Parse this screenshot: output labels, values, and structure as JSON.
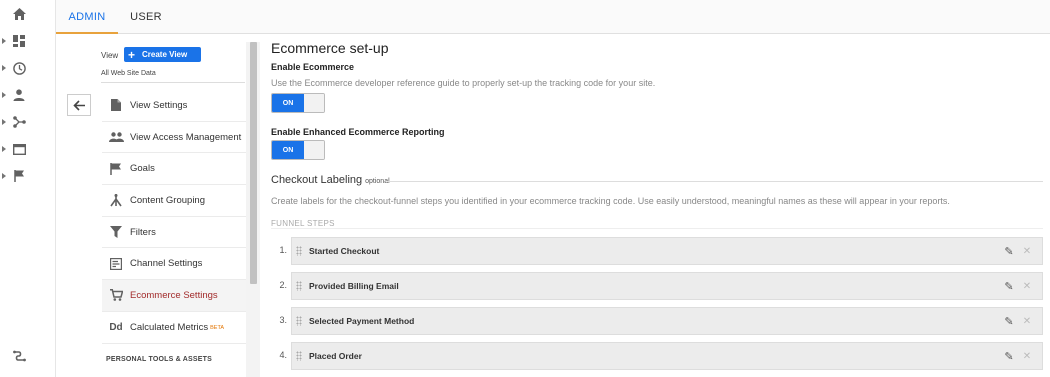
{
  "rail": {
    "icons": [
      "home-icon",
      "dashboards-icon",
      "clock-icon",
      "person-icon",
      "acquisition-icon",
      "behavior-icon",
      "flag-icon",
      "discover-icon"
    ]
  },
  "tabs": [
    {
      "label": "ADMIN",
      "active": true
    },
    {
      "label": "USER",
      "active": false
    }
  ],
  "panel": {
    "view_label": "View",
    "create_view_label": "Create View",
    "view_name": "All Web Site Data",
    "items": [
      {
        "label": "View Settings",
        "icon": "document-icon",
        "active": false
      },
      {
        "label": "View Access Management",
        "icon": "people-icon",
        "active": false
      },
      {
        "label": "Goals",
        "icon": "flag-icon",
        "active": false
      },
      {
        "label": "Content Grouping",
        "icon": "content-grouping-icon",
        "active": false
      },
      {
        "label": "Filters",
        "icon": "filter-icon",
        "active": false
      },
      {
        "label": "Channel Settings",
        "icon": "channel-icon",
        "active": false
      },
      {
        "label": "Ecommerce Settings",
        "icon": "cart-icon",
        "active": true
      },
      {
        "label": "Calculated Metrics",
        "icon": "dd-icon",
        "active": false,
        "badge": "BETA"
      }
    ],
    "section_heading": "PERSONAL TOOLS & ASSETS"
  },
  "main": {
    "title": "Ecommerce set-up",
    "enable_ecommerce_label": "Enable Ecommerce",
    "enable_ecommerce_desc": "Use the Ecommerce developer reference guide to properly set-up the tracking code for your site.",
    "toggle_on_label": "ON",
    "enhanced_label": "Enable Enhanced Ecommerce Reporting",
    "checkout_title": "Checkout Labeling",
    "checkout_optional": "optional",
    "checkout_desc": "Create labels for the checkout-funnel steps you identified in your ecommerce tracking code. Use easily understood, meaningful names as these will appear in your reports.",
    "funnel_heading": "FUNNEL STEPS",
    "steps": [
      {
        "num": "1.",
        "name": "Started Checkout"
      },
      {
        "num": "2.",
        "name": "Provided Billing Email"
      },
      {
        "num": "3.",
        "name": "Selected Payment Method"
      },
      {
        "num": "4.",
        "name": "Placed Order"
      }
    ]
  },
  "colors": {
    "accent": "#1a73e8",
    "active_item": "#a22b2b",
    "tab_underline": "#e8a23c"
  }
}
